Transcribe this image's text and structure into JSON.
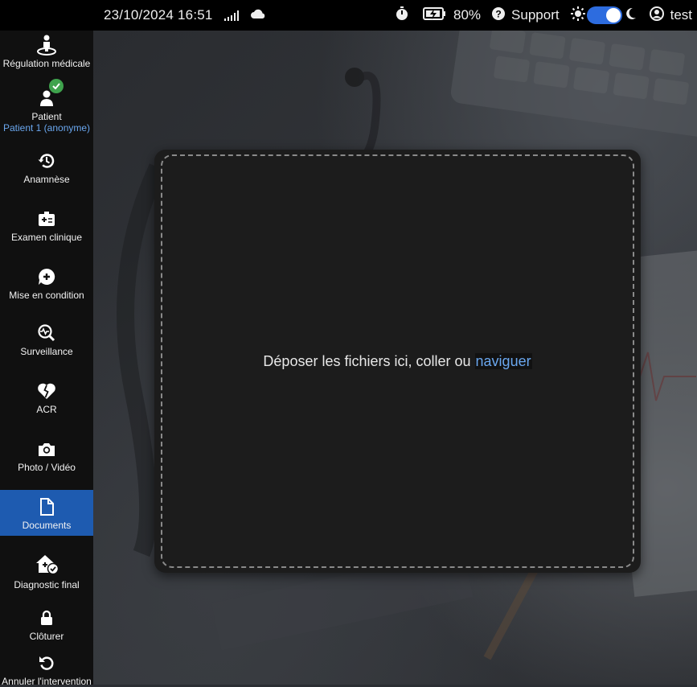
{
  "topbar": {
    "datetime": "23/10/2024 16:51",
    "battery": "80%",
    "support": "Support",
    "user": "test",
    "icons": [
      "signal-icon",
      "cloud-icon",
      "timer-icon",
      "battery-charging-icon",
      "help-icon",
      "sun-icon",
      "moon-icon",
      "user-icon"
    ],
    "toggle_state": "on"
  },
  "sidebar": {
    "items": [
      {
        "label": "Régulation médicale",
        "icon": "person-pin-icon"
      },
      {
        "label": "Patient",
        "sublabel": "Patient 1 (anonyme)",
        "icon": "patient-icon",
        "badge": "check"
      },
      {
        "label": "Anamnèse",
        "icon": "history-icon"
      },
      {
        "label": "Examen clinique",
        "icon": "medical-card-icon"
      },
      {
        "label": "Mise en condition",
        "icon": "chat-plus-icon"
      },
      {
        "label": "Surveillance",
        "icon": "monitoring-search-icon"
      },
      {
        "label": "ACR",
        "icon": "broken-heart-icon"
      },
      {
        "label": "Photo / Vidéo",
        "icon": "camera-icon"
      },
      {
        "label": "Documents",
        "icon": "document-icon",
        "active": true
      },
      {
        "label": "Diagnostic final",
        "icon": "home-medical-check-icon"
      },
      {
        "label": "Clôturer",
        "icon": "lock-icon"
      },
      {
        "label": "Annuler l'intervention",
        "icon": "undo-icon"
      }
    ]
  },
  "dropzone": {
    "text": "Déposer les fichiers ici, coller ou ",
    "link": "naviguer"
  },
  "colors": {
    "accent": "#2d6cdf",
    "active_nav": "#1e5bb0",
    "link": "#6aa7ef",
    "badge": "#3fa34d"
  }
}
